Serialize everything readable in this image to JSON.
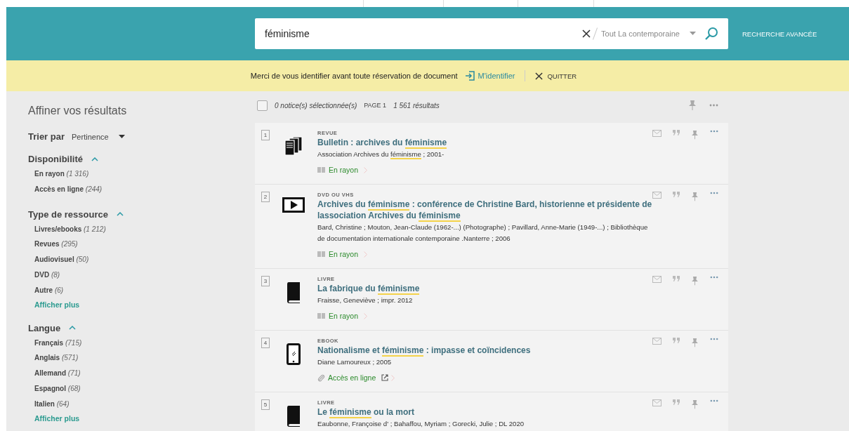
{
  "search": {
    "value": "féminisme",
    "scope": "Tout La contemporaine",
    "advanced": "RECHERCHE AVANCÉE"
  },
  "notice": {
    "message": "Merci de vous identifier avant toute réservation de document",
    "login": "M'identifier",
    "quit": "QUITTER"
  },
  "sidebar": {
    "title": "Affiner vos résultats",
    "sort": {
      "label": "Trier par",
      "value": "Pertinence"
    },
    "facets": [
      {
        "title": "Disponibilité",
        "expanded": true,
        "items": [
          {
            "label": "En rayon",
            "count": "(1 316)"
          },
          {
            "label": "Accès en ligne",
            "count": "(244)"
          }
        ]
      },
      {
        "title": "Type de ressource",
        "expanded": true,
        "items": [
          {
            "label": "Livres/ebooks",
            "count": "(1 212)"
          },
          {
            "label": "Revues",
            "count": "(295)"
          },
          {
            "label": "Audiovisuel",
            "count": "(50)"
          },
          {
            "label": "DVD",
            "count": "(8)"
          },
          {
            "label": "Autre",
            "count": "(6)"
          }
        ],
        "more": "Afficher plus"
      },
      {
        "title": "Langue",
        "expanded": true,
        "items": [
          {
            "label": "Français",
            "count": "(715)"
          },
          {
            "label": "Anglais",
            "count": "(571)"
          },
          {
            "label": "Allemand",
            "count": "(71)"
          },
          {
            "label": "Espagnol",
            "count": "(68)"
          },
          {
            "label": "Italien",
            "count": "(64)"
          }
        ],
        "more": "Afficher plus"
      }
    ]
  },
  "toolbar": {
    "selected_all": false,
    "selection": "0 notice(s) sélectionnée(s)",
    "page": "PAGE 1",
    "total": "1 561 résultats"
  },
  "results": [
    {
      "number": "1",
      "kind": "revue",
      "type": "REVUE",
      "title": [
        {
          "text": "Bulletin : archives du ",
          "highlight": false
        },
        {
          "text": "féminisme",
          "highlight": true
        }
      ],
      "meta": [
        {
          "text": "Association Archives du ",
          "highlight": false
        },
        {
          "text": "féminisme",
          "highlight": true
        },
        {
          "text": " ; 2001-",
          "highlight": false
        }
      ],
      "availability": {
        "kind": "shelf",
        "label": "En rayon"
      }
    },
    {
      "number": "2",
      "kind": "video",
      "type": "DVD OU VHS",
      "title": [
        {
          "text": "Archives du ",
          "highlight": false
        },
        {
          "text": "féminisme",
          "highlight": true
        },
        {
          "text": " : conférence de Christine Bard, historienne et présidente de lassociation Archives du ",
          "highlight": false
        },
        {
          "text": "féminisme",
          "highlight": true
        }
      ],
      "meta": [
        {
          "text": "Bard, Christine ; Mouton, Jean-Claude (1962-...) (Photographe) ; Pavillard, Anne-Marie (1949-...) ; Bibliothèque de documentation internationale contemporaine .Nanterre ; 2006",
          "highlight": false
        }
      ],
      "availability": {
        "kind": "shelf",
        "label": "En rayon"
      }
    },
    {
      "number": "3",
      "kind": "book",
      "type": "LIVRE",
      "title": [
        {
          "text": "La fabrique du ",
          "highlight": false
        },
        {
          "text": "féminisme",
          "highlight": true
        }
      ],
      "meta": [
        {
          "text": "Fraisse, Geneviève ; impr. 2012",
          "highlight": false
        }
      ],
      "availability": {
        "kind": "shelf",
        "label": "En rayon"
      }
    },
    {
      "number": "4",
      "kind": "ebook",
      "type": "EBOOK",
      "title": [
        {
          "text": "Nationalisme et ",
          "highlight": false
        },
        {
          "text": "féminisme",
          "highlight": true
        },
        {
          "text": " : impasse et coïncidences",
          "highlight": false
        }
      ],
      "meta": [
        {
          "text": "Diane Lamoureux ; 2005",
          "highlight": false
        }
      ],
      "availability": {
        "kind": "online",
        "label": "Accès en ligne"
      }
    },
    {
      "number": "5",
      "kind": "book",
      "type": "LIVRE",
      "title": [
        {
          "text": "Le ",
          "highlight": false
        },
        {
          "text": "féminisme",
          "highlight": true
        },
        {
          "text": " ou la mort",
          "highlight": false
        }
      ],
      "meta": [
        {
          "text": "Eaubonne, Françoise d' ; Bahaffou, Myriam ; Gorecki, Julie ; DL 2020",
          "highlight": false
        }
      ]
    }
  ]
}
